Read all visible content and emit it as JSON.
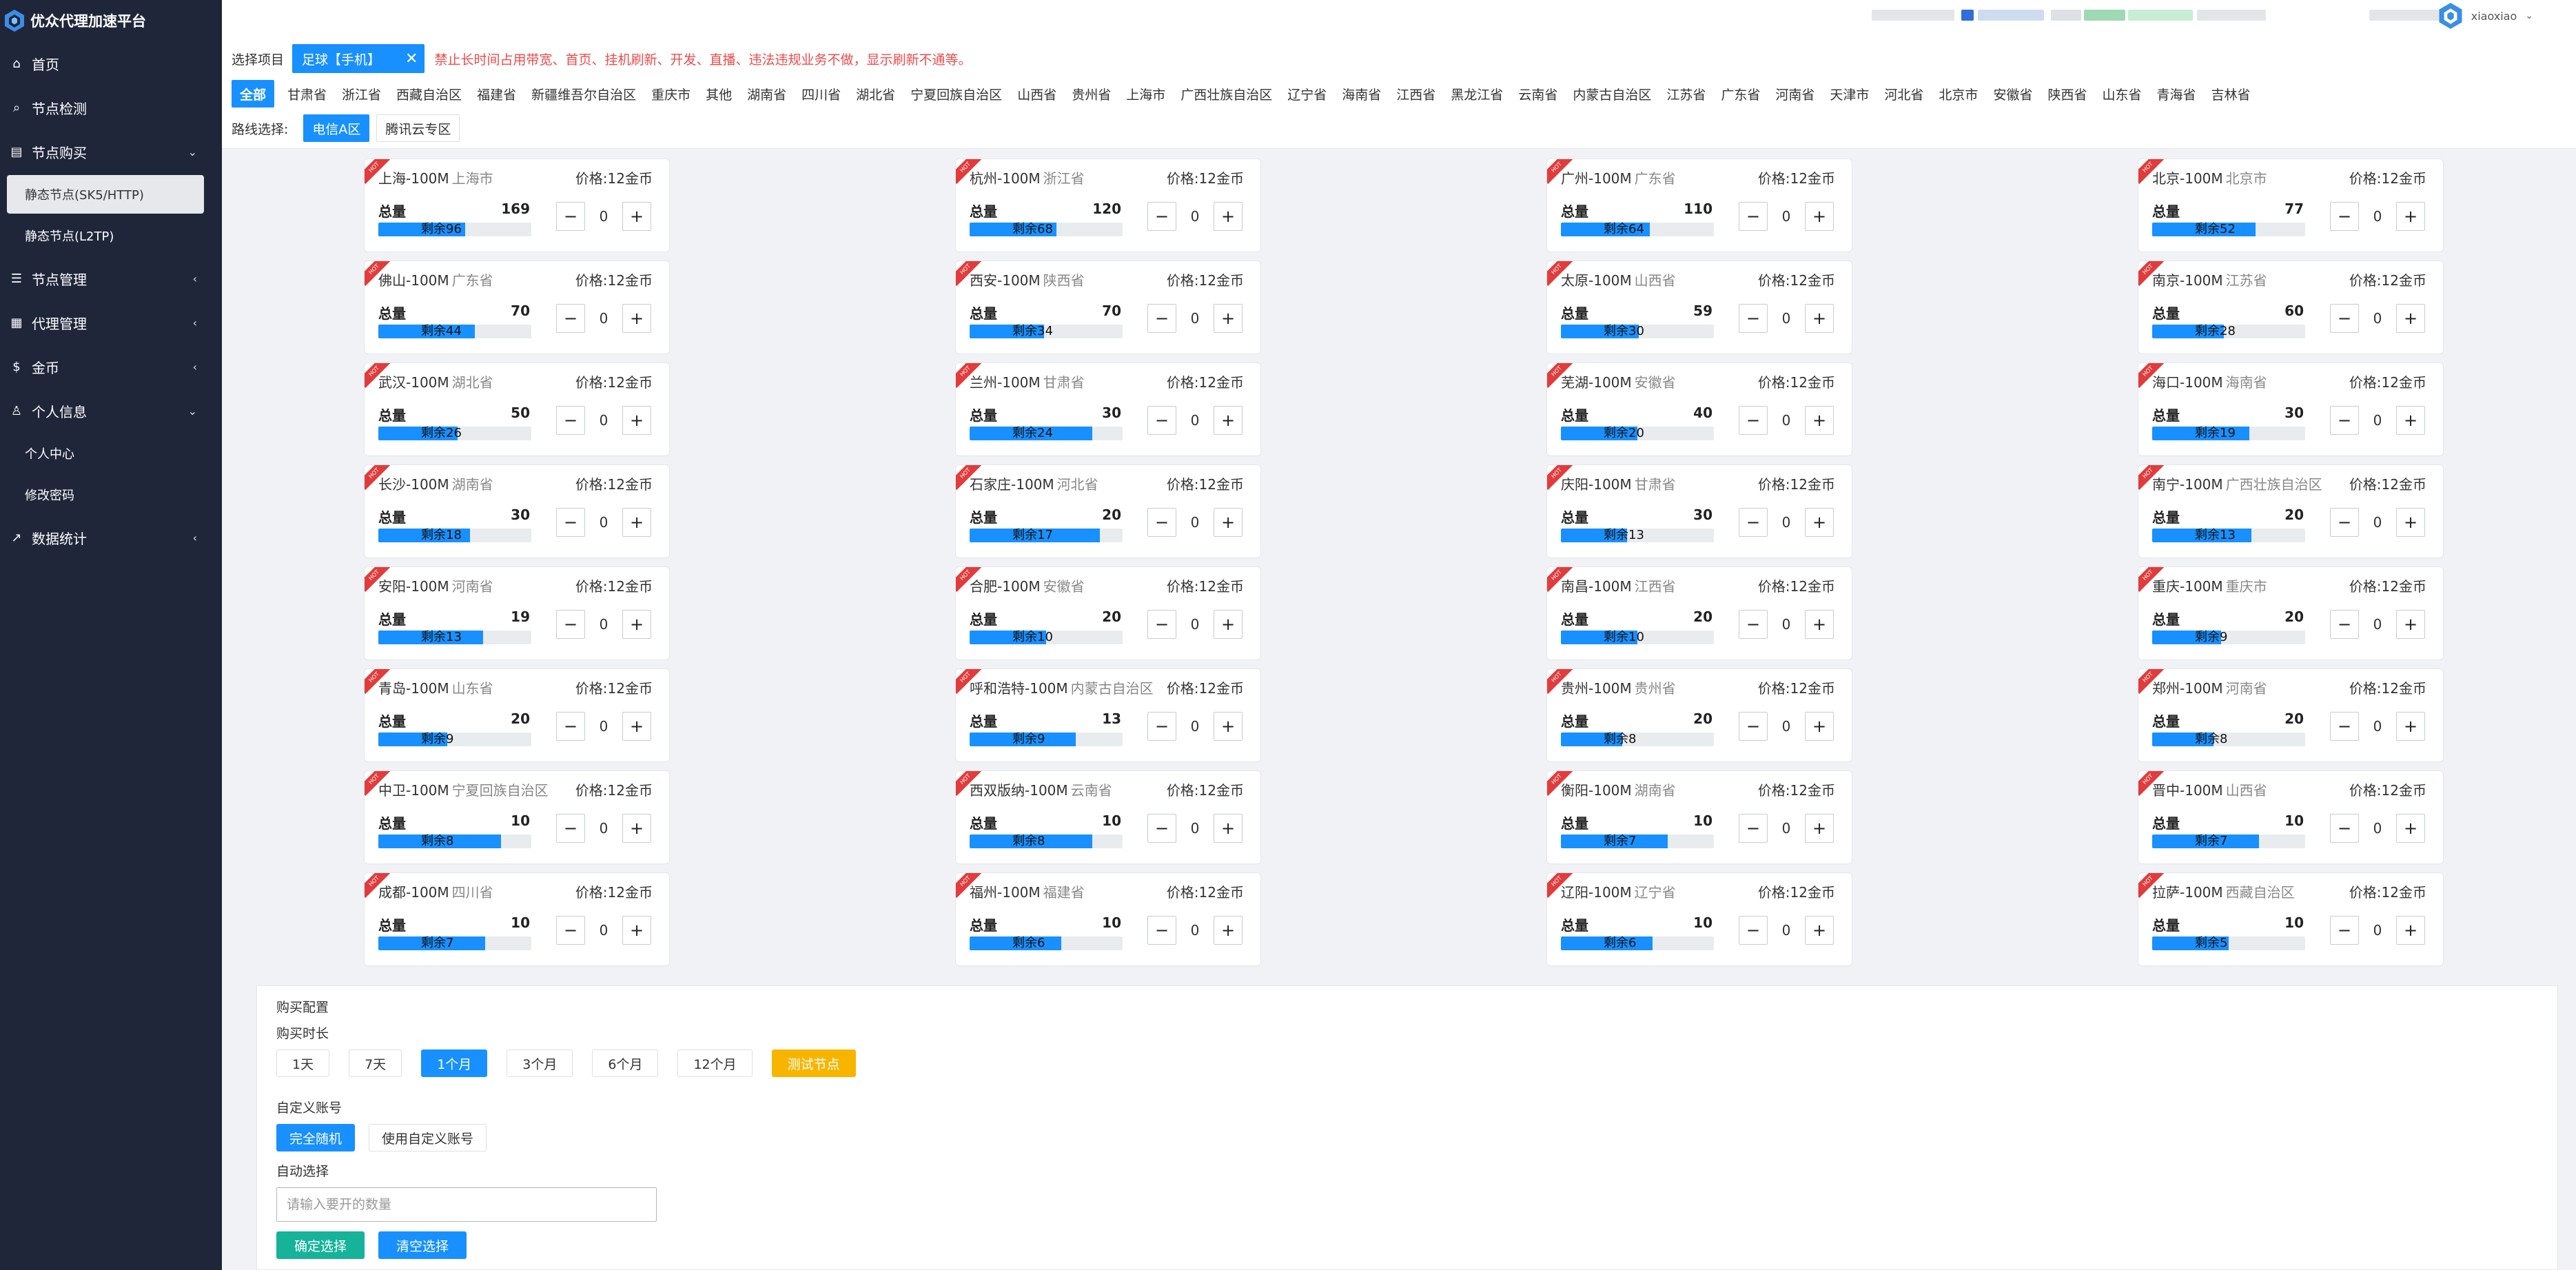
{
  "app": {
    "title": "优众代理加速平台"
  },
  "sidebar": {
    "items": [
      {
        "label": "首页",
        "icon": "home-icon"
      },
      {
        "label": "节点检测",
        "icon": "search-icon"
      },
      {
        "label": "节点购买",
        "icon": "cart-icon",
        "expanded": true
      },
      {
        "label": "节点管理",
        "icon": "list-icon"
      },
      {
        "label": "代理管理",
        "icon": "grid-icon"
      },
      {
        "label": "金币",
        "icon": "dollar-icon"
      },
      {
        "label": "个人信息",
        "icon": "user-icon",
        "expanded": true
      },
      {
        "label": "数据统计",
        "icon": "chart-icon"
      }
    ],
    "purchase_sub": [
      "静态节点(SK5/HTTP)",
      "静态节点(L2TP)"
    ],
    "profile_sub": [
      "个人中心",
      "修改密码"
    ]
  },
  "header": {
    "username": "xiaoxiao"
  },
  "filter": {
    "select_label": "选择项目",
    "selected_project": "足球【手机】",
    "warning": "禁止长时间占用带宽、首页、挂机刷新、开发、直播、违法违规业务不做，显示刷新不通等。",
    "provinces": [
      "全部",
      "甘肃省",
      "浙江省",
      "西藏自治区",
      "福建省",
      "新疆维吾尔自治区",
      "重庆市",
      "其他",
      "湖南省",
      "四川省",
      "湖北省",
      "宁夏回族自治区",
      "山西省",
      "贵州省",
      "上海市",
      "广西壮族自治区",
      "辽宁省",
      "海南省",
      "江西省",
      "黑龙江省",
      "云南省",
      "内蒙古自治区",
      "江苏省",
      "广东省",
      "河南省",
      "天津市",
      "河北省",
      "北京市",
      "安徽省",
      "陕西省",
      "山东省",
      "青海省",
      "吉林省"
    ],
    "route_label": "路线选择:",
    "routes": [
      "电信A区",
      "腾讯云专区"
    ]
  },
  "card_labels": {
    "total": "总量",
    "remain_prefix": "剩余",
    "ribbon": "HOT"
  },
  "nodes": [
    {
      "city": "上海-100M",
      "province": "上海市",
      "price": "价格:12金币",
      "total": 169,
      "remain": 96,
      "qty": 0
    },
    {
      "city": "杭州-100M",
      "province": "浙江省",
      "price": "价格:12金币",
      "total": 120,
      "remain": 68,
      "qty": 0
    },
    {
      "city": "广州-100M",
      "province": "广东省",
      "price": "价格:12金币",
      "total": 110,
      "remain": 64,
      "qty": 0
    },
    {
      "city": "北京-100M",
      "province": "北京市",
      "price": "价格:12金币",
      "total": 77,
      "remain": 52,
      "qty": 0
    },
    {
      "city": "佛山-100M",
      "province": "广东省",
      "price": "价格:12金币",
      "total": 70,
      "remain": 44,
      "qty": 0
    },
    {
      "city": "西安-100M",
      "province": "陕西省",
      "price": "价格:12金币",
      "total": 70,
      "remain": 34,
      "qty": 0
    },
    {
      "city": "太原-100M",
      "province": "山西省",
      "price": "价格:12金币",
      "total": 59,
      "remain": 30,
      "qty": 0
    },
    {
      "city": "南京-100M",
      "province": "江苏省",
      "price": "价格:12金币",
      "total": 60,
      "remain": 28,
      "qty": 0
    },
    {
      "city": "武汉-100M",
      "province": "湖北省",
      "price": "价格:12金币",
      "total": 50,
      "remain": 26,
      "qty": 0
    },
    {
      "city": "兰州-100M",
      "province": "甘肃省",
      "price": "价格:12金币",
      "total": 30,
      "remain": 24,
      "qty": 0
    },
    {
      "city": "芜湖-100M",
      "province": "安徽省",
      "price": "价格:12金币",
      "total": 40,
      "remain": 20,
      "qty": 0
    },
    {
      "city": "海口-100M",
      "province": "海南省",
      "price": "价格:12金币",
      "total": 30,
      "remain": 19,
      "qty": 0
    },
    {
      "city": "长沙-100M",
      "province": "湖南省",
      "price": "价格:12金币",
      "total": 30,
      "remain": 18,
      "qty": 0
    },
    {
      "city": "石家庄-100M",
      "province": "河北省",
      "price": "价格:12金币",
      "total": 20,
      "remain": 17,
      "qty": 0
    },
    {
      "city": "庆阳-100M",
      "province": "甘肃省",
      "price": "价格:12金币",
      "total": 30,
      "remain": 13,
      "qty": 0
    },
    {
      "city": "南宁-100M",
      "province": "广西壮族自治区",
      "price": "价格:12金币",
      "total": 20,
      "remain": 13,
      "qty": 0
    },
    {
      "city": "安阳-100M",
      "province": "河南省",
      "price": "价格:12金币",
      "total": 19,
      "remain": 13,
      "qty": 0
    },
    {
      "city": "合肥-100M",
      "province": "安徽省",
      "price": "价格:12金币",
      "total": 20,
      "remain": 10,
      "qty": 0
    },
    {
      "city": "南昌-100M",
      "province": "江西省",
      "price": "价格:12金币",
      "total": 20,
      "remain": 10,
      "qty": 0
    },
    {
      "city": "重庆-100M",
      "province": "重庆市",
      "price": "价格:12金币",
      "total": 20,
      "remain": 9,
      "qty": 0
    },
    {
      "city": "青岛-100M",
      "province": "山东省",
      "price": "价格:12金币",
      "total": 20,
      "remain": 9,
      "qty": 0
    },
    {
      "city": "呼和浩特-100M",
      "province": "内蒙古自治区",
      "price": "价格:12金币",
      "total": 13,
      "remain": 9,
      "qty": 0
    },
    {
      "city": "贵州-100M",
      "province": "贵州省",
      "price": "价格:12金币",
      "total": 20,
      "remain": 8,
      "qty": 0
    },
    {
      "city": "郑州-100M",
      "province": "河南省",
      "price": "价格:12金币",
      "total": 20,
      "remain": 8,
      "qty": 0
    },
    {
      "city": "中卫-100M",
      "province": "宁夏回族自治区",
      "price": "价格:12金币",
      "total": 10,
      "remain": 8,
      "qty": 0
    },
    {
      "city": "西双版纳-100M",
      "province": "云南省",
      "price": "价格:12金币",
      "total": 10,
      "remain": 8,
      "qty": 0
    },
    {
      "city": "衡阳-100M",
      "province": "湖南省",
      "price": "价格:12金币",
      "total": 10,
      "remain": 7,
      "qty": 0
    },
    {
      "city": "晋中-100M",
      "province": "山西省",
      "price": "价格:12金币",
      "total": 10,
      "remain": 7,
      "qty": 0
    },
    {
      "city": "成都-100M",
      "province": "四川省",
      "price": "价格:12金币",
      "total": 10,
      "remain": 7,
      "qty": 0
    },
    {
      "city": "福州-100M",
      "province": "福建省",
      "price": "价格:12金币",
      "total": 10,
      "remain": 6,
      "qty": 0
    },
    {
      "city": "辽阳-100M",
      "province": "辽宁省",
      "price": "价格:12金币",
      "total": 10,
      "remain": 6,
      "qty": 0
    },
    {
      "city": "拉萨-100M",
      "province": "西藏自治区",
      "price": "价格:12金币",
      "total": 10,
      "remain": 5,
      "qty": 0
    }
  ],
  "config": {
    "title": "购买配置",
    "duration_label": "购买时长",
    "durations": [
      "1天",
      "7天",
      "1个月",
      "3个月",
      "6个月",
      "12个月",
      "测试节点"
    ],
    "account_label": "自定义账号",
    "account_options": [
      "完全随机",
      "使用自定义账号"
    ],
    "auto_label": "自动选择",
    "auto_placeholder": "请输入要开的数量",
    "confirm_label": "确定选择",
    "clear_label": "清空选择"
  },
  "colors": {
    "accent": "#1890ff",
    "sidebar_bg": "#20263a",
    "warning": "#f04b4b",
    "test": "#f7b500",
    "confirm": "#16b39a"
  }
}
